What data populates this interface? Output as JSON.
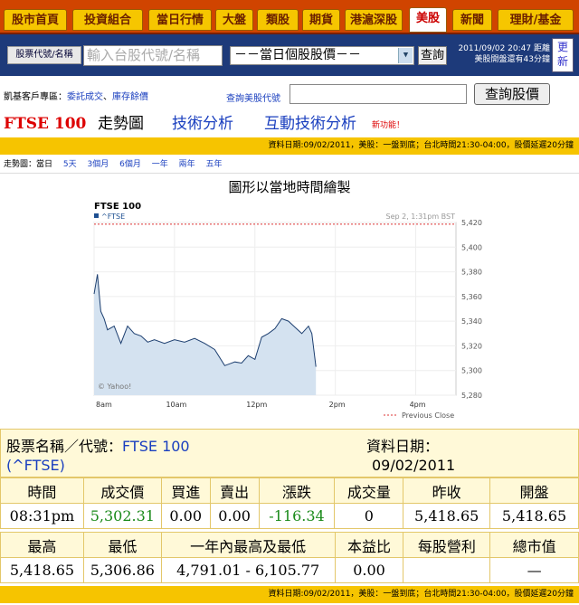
{
  "nav": {
    "tabs": [
      "股市首頁",
      "投資組合",
      "當日行情",
      "大盤",
      "類股",
      "期貨",
      "港滬深股",
      "美股",
      "新聞",
      "理財/基金"
    ],
    "active_tab": "美股"
  },
  "search": {
    "type_button": "股票代號/名稱",
    "placeholder": "輸入台股代號/名稱",
    "select_value": "－－當日個股股價－－",
    "go_label": "查詢",
    "time_line1": "2011/09/02 20:47 距離",
    "time_line2": "美股開盤還有43分鐘",
    "refresh_label": "更新"
  },
  "vip": {
    "label": "凱基客戶專區：",
    "link1": "委託成交",
    "sep": "、",
    "link2": "庫存餘價"
  },
  "us_query": {
    "label": "查詢美股代號",
    "button": "查詢股價"
  },
  "title": {
    "symbol": "FTSE 100",
    "trend": "走勢圖",
    "tech": "技術分析",
    "interactive": "互動技術分析",
    "new_feature": "新功能！"
  },
  "info_note": "資料日期:09/02/2011，美股：一盤到底；台北時間21:30-04:00，股價延遲20分鐘",
  "periods": {
    "label": "走勢圖：當日",
    "items": [
      "5天",
      "3個月",
      "6個月",
      "一年",
      "兩年",
      "五年"
    ]
  },
  "chart_caption": "圖形以當地時間繪製",
  "chart_data": {
    "type": "area",
    "title": "FTSE 100",
    "legend": "^FTSE",
    "timestamp": "Sep 2, 1:31pm BST",
    "watermark": "© Yahoo!",
    "prev_close_label": "Previous Close",
    "x_ticks": [
      "8am",
      "10am",
      "12pm",
      "2pm",
      "4pm"
    ],
    "y_ticks": [
      5420,
      5400,
      5380,
      5360,
      5340,
      5320,
      5300,
      5280
    ],
    "ylim": [
      5280,
      5420
    ],
    "previous_close": 5418.65,
    "x": [
      "8:00",
      "8:05",
      "8:10",
      "8:15",
      "8:20",
      "8:30",
      "8:40",
      "8:50",
      "9:00",
      "9:10",
      "9:20",
      "9:30",
      "9:45",
      "10:00",
      "10:15",
      "10:30",
      "10:45",
      "11:00",
      "11:15",
      "11:30",
      "11:40",
      "11:50",
      "12:00",
      "12:10",
      "12:20",
      "12:30",
      "12:40",
      "12:50",
      "13:00",
      "13:10",
      "13:20",
      "13:25",
      "13:31"
    ],
    "values": [
      5362,
      5378,
      5348,
      5342,
      5333,
      5336,
      5322,
      5336,
      5330,
      5328,
      5323,
      5325,
      5322,
      5325,
      5323,
      5326,
      5322,
      5317,
      5304,
      5307,
      5306,
      5312,
      5309,
      5327,
      5330,
      5334,
      5342,
      5340,
      5335,
      5330,
      5336,
      5330,
      5303
    ]
  },
  "summary": {
    "name_label": "股票名稱／代號：",
    "name_value": "FTSE 100",
    "code": "(^FTSE)",
    "date_label": "資料日期：",
    "date_value": "09/02/2011"
  },
  "quote_headers1": [
    "時間",
    "成交價",
    "買進",
    "賣出",
    "漲跌",
    "成交量",
    "昨收",
    "開盤"
  ],
  "quote_values1": [
    "08:31pm",
    "5,302.31",
    "0.00",
    "0.00",
    "-116.34",
    "0",
    "5,418.65",
    "5,418.65"
  ],
  "quote_headers2": [
    "最高",
    "最低",
    "一年內最高及最低",
    "本益比",
    "每股營利",
    "總市值"
  ],
  "quote_values2": [
    "5,418.65",
    "5,306.86",
    "4,791.01 - 6,105.77",
    "0.00",
    "",
    "—"
  ],
  "colors": {
    "nav_bg": "#d04400",
    "tab": "#f6c600",
    "search_bg": "#1d3a7a",
    "info_bar": "#f6c400",
    "up_green": "#1a8a1a",
    "link": "#1a3fbf"
  }
}
